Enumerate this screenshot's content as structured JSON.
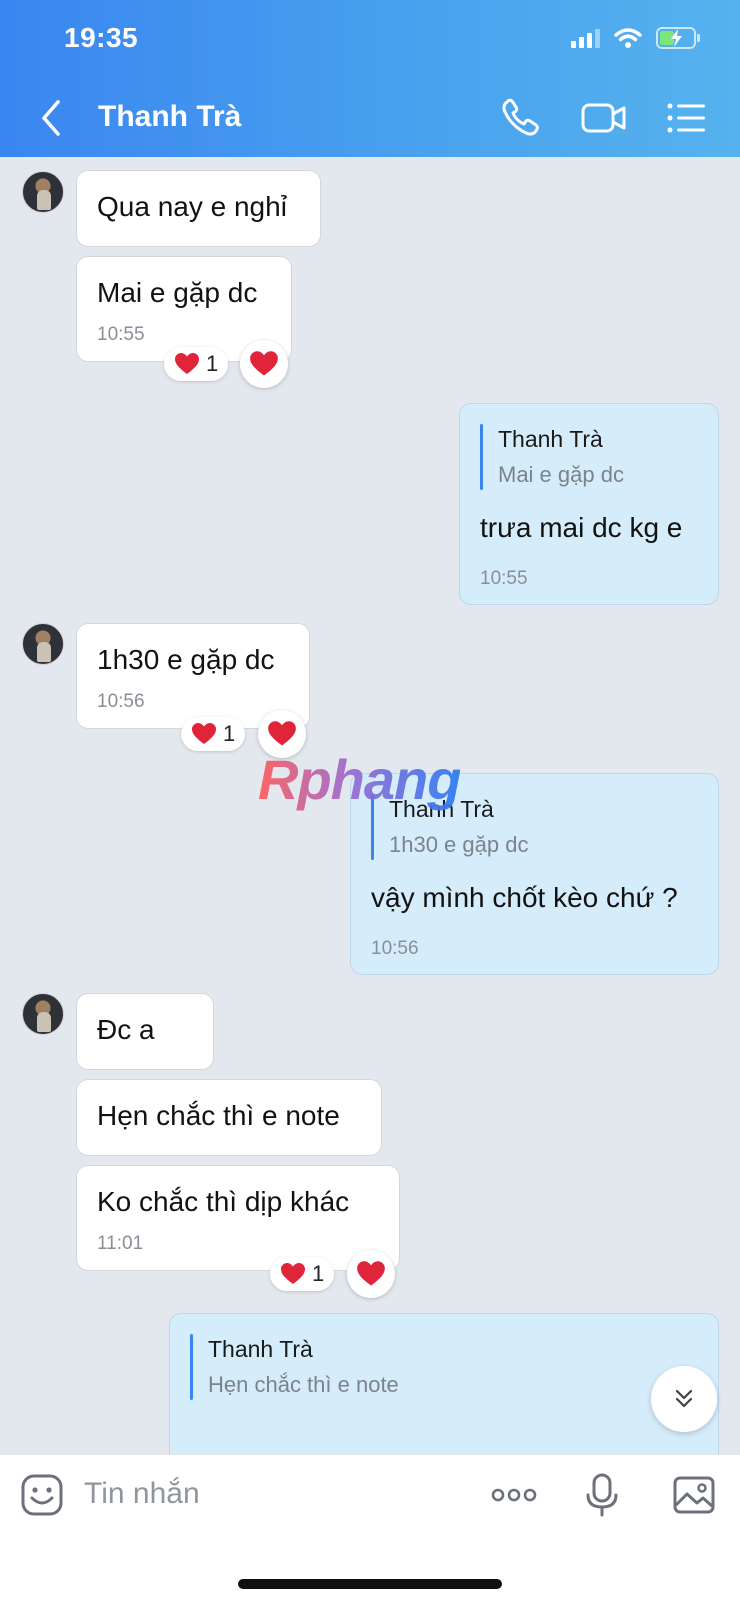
{
  "status_bar": {
    "time": "19:35"
  },
  "header": {
    "title": "Thanh Trà"
  },
  "messages": [
    {
      "text": "Qua nay e nghỉ"
    },
    {
      "text": "Mai e gặp dc",
      "time": "10:55",
      "reaction_count": "1"
    },
    {
      "quote_author": "Thanh Trà",
      "quote_text": "Mai e gặp dc",
      "text": "trưa mai dc kg e",
      "time": "10:55"
    },
    {
      "text": "1h30 e gặp dc",
      "time": "10:56",
      "reaction_count": "1"
    },
    {
      "quote_author": "Thanh Trà",
      "quote_text": "1h30 e gặp dc",
      "text": "vậy mình chốt kèo chứ ?",
      "time": "10:56"
    },
    {
      "text": "Đc a"
    },
    {
      "text": "Hẹn chắc thì e note"
    },
    {
      "text": "Ko chắc thì dịp khác",
      "time": "11:01",
      "reaction_count": "1"
    },
    {
      "quote_author": "Thanh Trà",
      "quote_text": "Hẹn chắc thì e note"
    }
  ],
  "watermark": "Rphang",
  "input": {
    "placeholder": "Tin nhắn"
  },
  "icons": {
    "reaction": "heart-icon",
    "back": "back-chevron-icon",
    "call": "phone-icon",
    "video": "video-camera-icon",
    "menu": "list-menu-icon",
    "sticker": "sticker-smile-icon",
    "more": "more-dots-icon",
    "voice": "microphone-icon",
    "image": "image-icon",
    "scroll": "double-chevron-down-icon"
  },
  "colors": {
    "header_blue": "#3a86f0",
    "my_bubble": "#d5ecfa",
    "heart": "#e0243a"
  }
}
